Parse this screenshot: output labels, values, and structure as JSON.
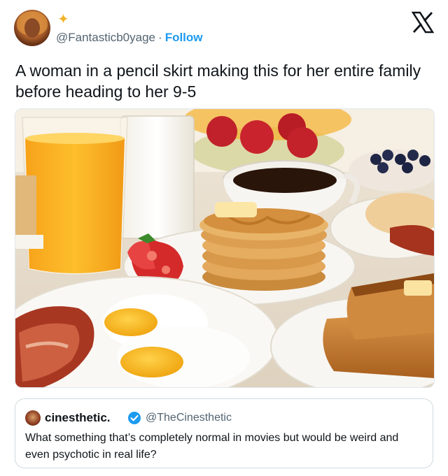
{
  "author": {
    "handle": "@Fantasticb0yage",
    "separator": "·",
    "follow_label": "Follow",
    "sparkle_icon": "sparkle-icon"
  },
  "close_icon": "x-logo-icon",
  "post": {
    "text": "A woman in a pencil skirt making this for her entire family before heading to her 9-5"
  },
  "quoted": {
    "name": "cinesthetic.",
    "handle": "@TheCinesthetic",
    "verified_color": "#1d9bf0",
    "text": "What something that’s completely normal in movies but would be weird and even psychotic in real life?"
  },
  "colors": {
    "accent": "#1d9bf0",
    "text": "#0f1419",
    "muted": "#536471"
  }
}
